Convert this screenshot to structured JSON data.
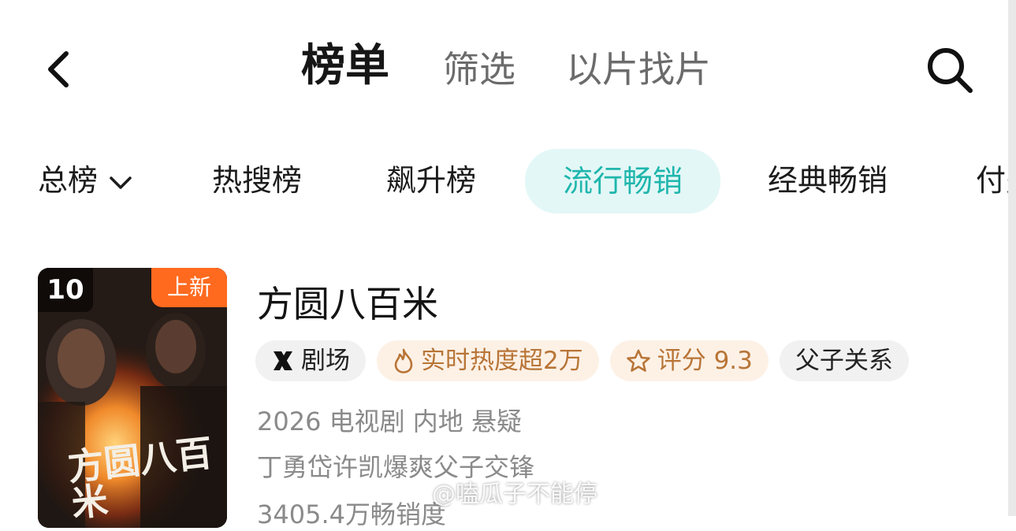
{
  "header": {
    "tabs": [
      {
        "label": "榜单",
        "active": true
      },
      {
        "label": "筛选",
        "active": false
      },
      {
        "label": "以片找片",
        "active": false
      }
    ]
  },
  "categories": {
    "items": [
      {
        "label": "总榜",
        "dropdown": true
      },
      {
        "label": "热搜榜"
      },
      {
        "label": "飙升榜"
      },
      {
        "label": "流行畅销",
        "active": true
      },
      {
        "label": "经典畅销"
      },
      {
        "label": "付费"
      }
    ],
    "active_color": "#1fb6ad",
    "active_bg": "#e3f7f6"
  },
  "item": {
    "rank": "10",
    "badge": "上新",
    "poster_title": "方圆八百米",
    "title": "方圆八百米",
    "tags": [
      {
        "label": "剧场",
        "icon": "x-theater-icon"
      },
      {
        "label": "实时热度超2万",
        "icon": "flame-icon"
      },
      {
        "label": "评分 9.3",
        "icon": "star-icon"
      },
      {
        "label": "父子关系"
      }
    ],
    "meta_line": "2026 电视剧 内地 悬疑",
    "description": "丁勇岱许凯爆爽父子交锋",
    "sales": "3405.4万畅销度"
  },
  "watermark": "@嗑瓜子不能停",
  "colors": {
    "badge": "#ff6a1f",
    "warm_tag_text": "#b87537"
  }
}
